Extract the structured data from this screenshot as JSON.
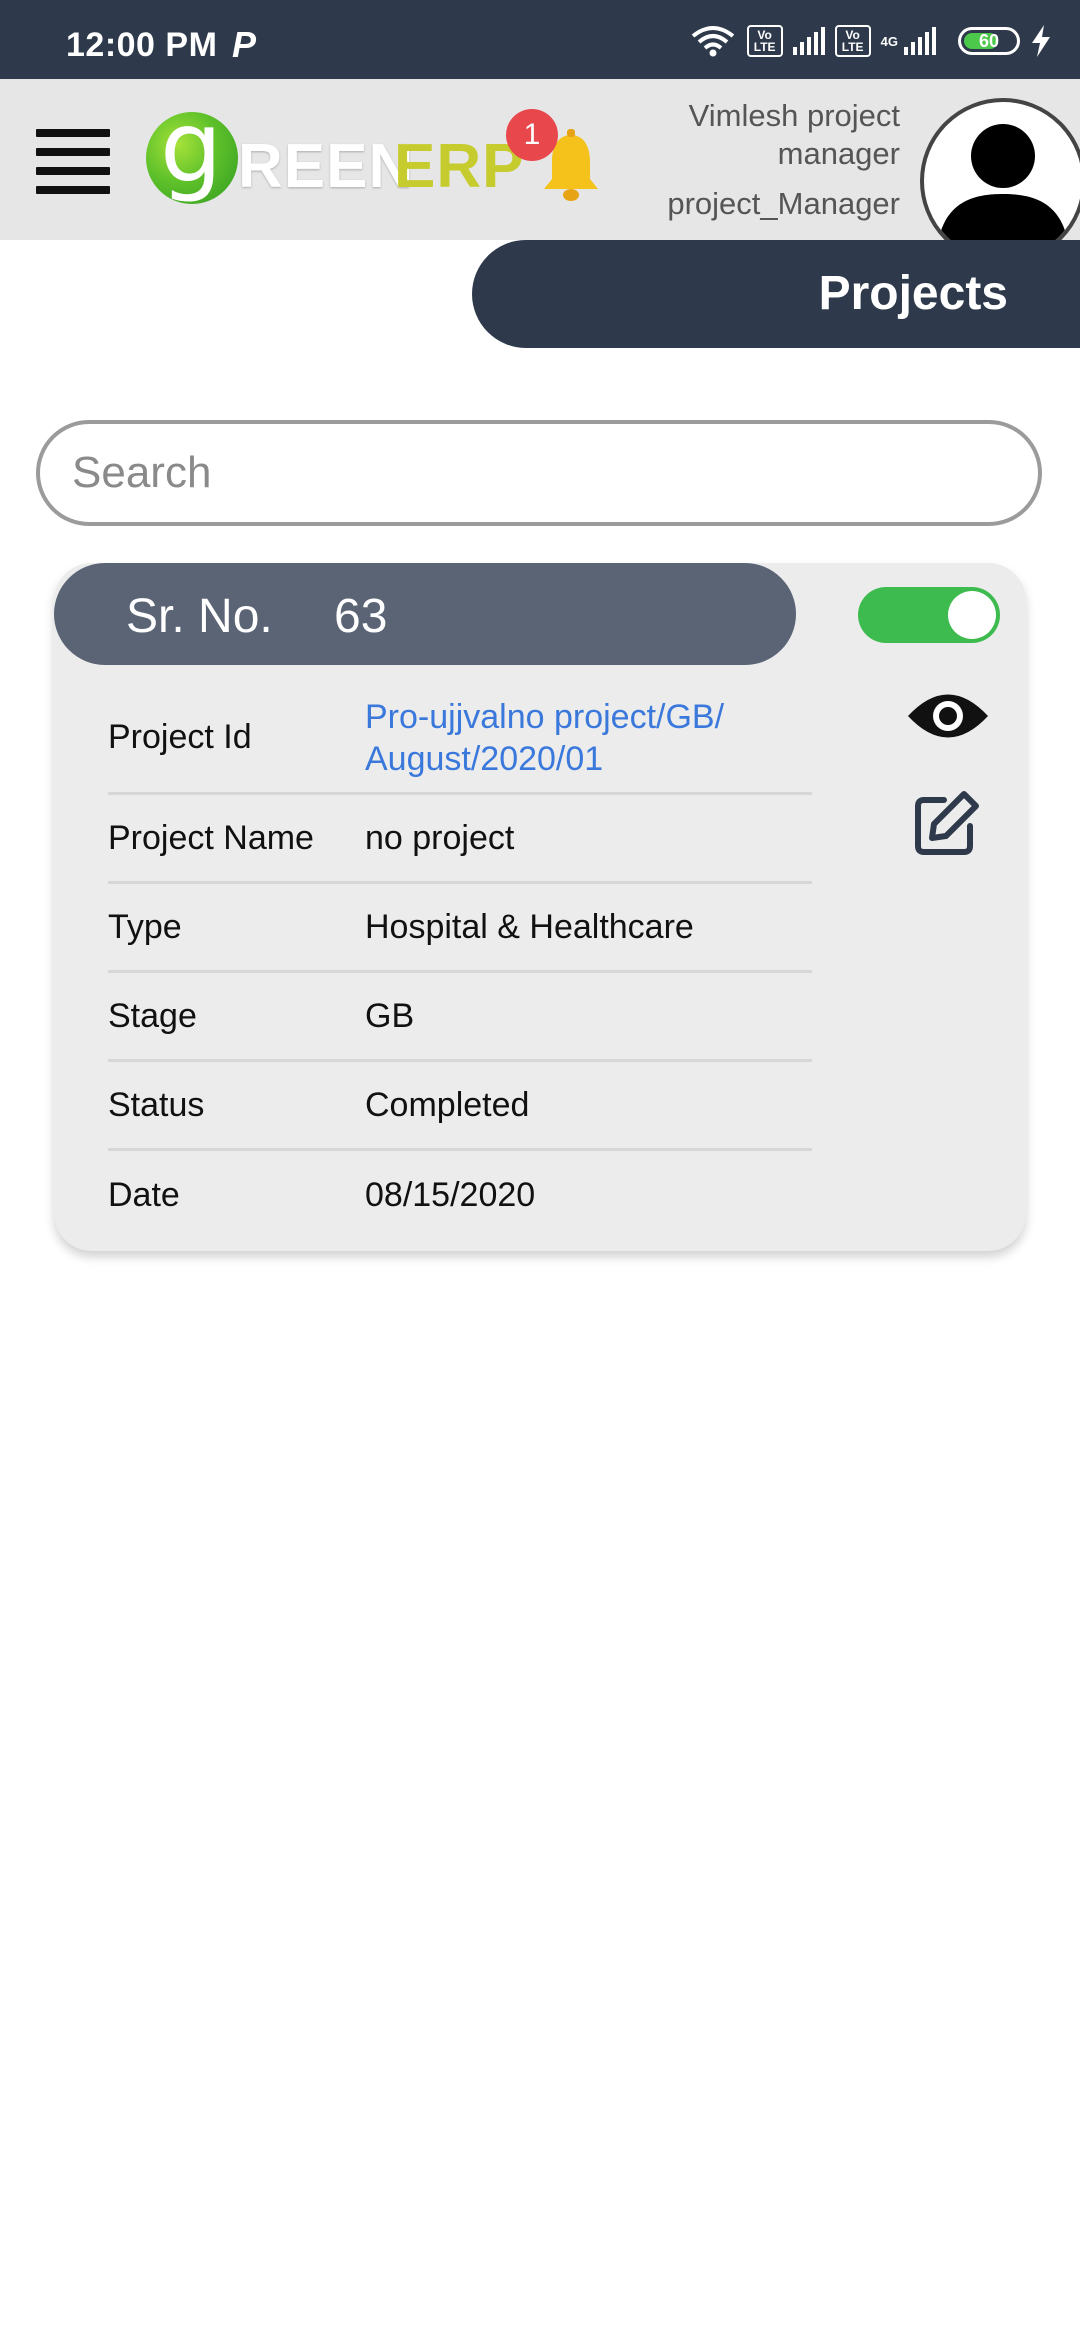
{
  "status_bar": {
    "time": "12:00 PM",
    "notification_letter": "P",
    "battery": "60",
    "network_4g": "4G",
    "volte1": "Vo LTE",
    "volte2": "Vo LTE"
  },
  "header": {
    "logo": {
      "g": "g",
      "reen": "REEN",
      "erp": "ERP"
    },
    "notification_count": "1",
    "user_name": "Vimlesh project manager",
    "user_role": "project_Manager"
  },
  "page_title": "Projects",
  "search": {
    "placeholder": "Search",
    "value": ""
  },
  "card": {
    "sr_label": "Sr. No.",
    "sr_value": "63",
    "active": true,
    "rows": [
      {
        "key": "Project Id",
        "value": "Pro-ujjvalno project/GB/ August/2020/01"
      },
      {
        "key": "Project Name",
        "value": "no project"
      },
      {
        "key": "Type",
        "value": "Hospital & Healthcare"
      },
      {
        "key": "Stage",
        "value": "GB"
      },
      {
        "key": "Status",
        "value": "Completed"
      },
      {
        "key": "Date",
        "value": "08/15/2020"
      }
    ]
  },
  "colors": {
    "dark": "#2e3a4b",
    "pill": "#5b6475",
    "toggle_on": "#3dbb4f",
    "link": "#3a78db",
    "badge": "#e8474c"
  }
}
